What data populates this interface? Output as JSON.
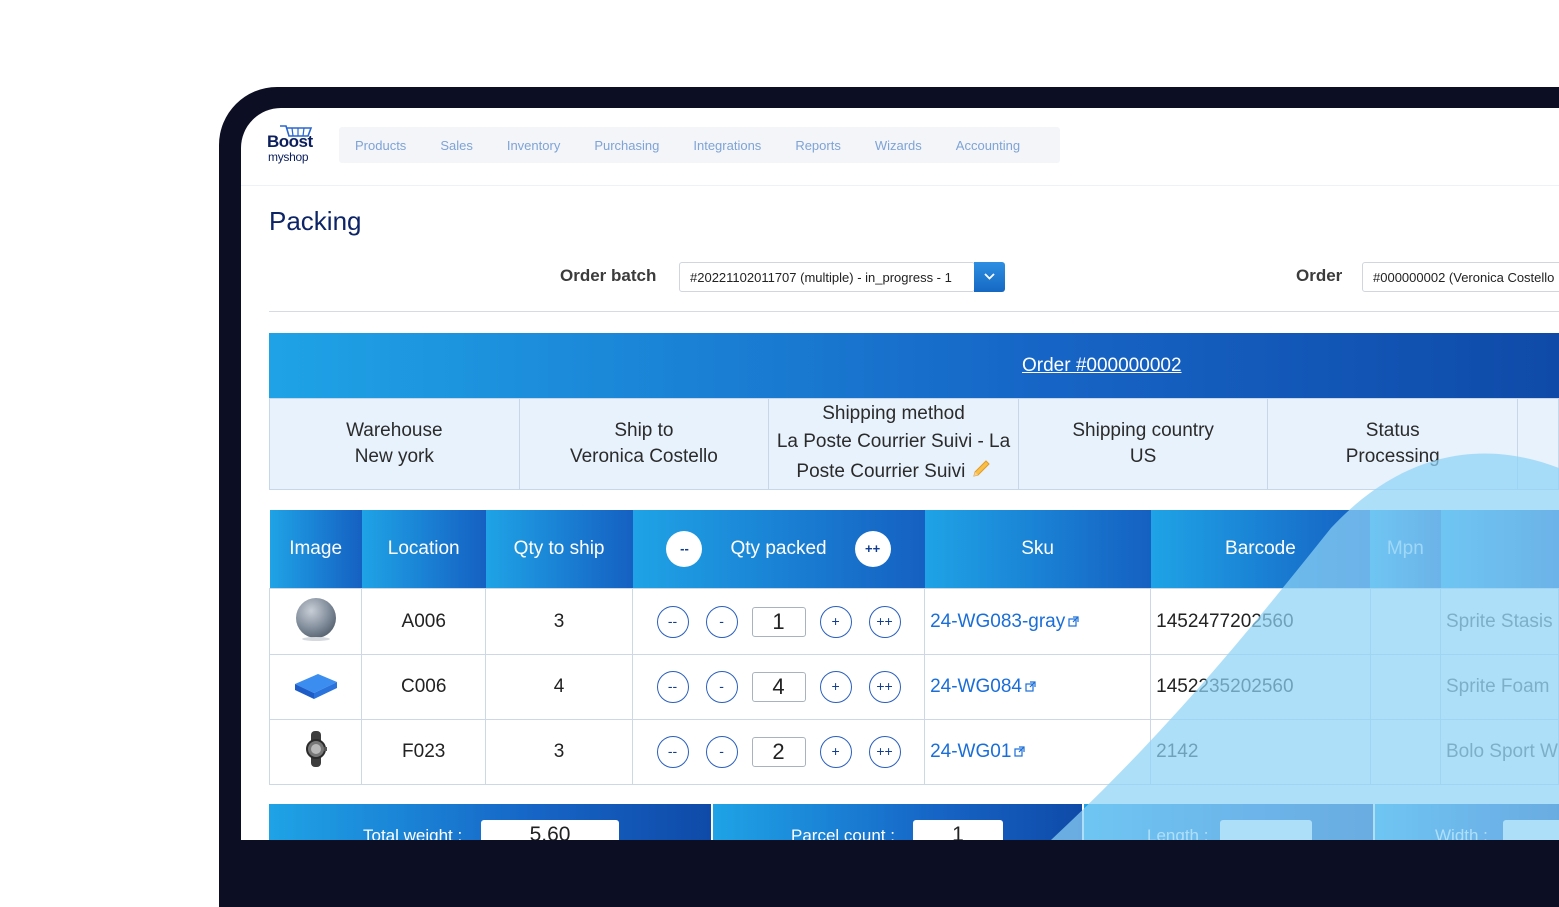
{
  "brand": {
    "logo_top": "Boost",
    "logo_bottom": "myshop"
  },
  "nav": [
    "Products",
    "Sales",
    "Inventory",
    "Purchasing",
    "Integrations",
    "Reports",
    "Wizards",
    "Accounting"
  ],
  "page": {
    "title": "Packing"
  },
  "filters": {
    "order_batch_label": "Order batch",
    "order_batch_value": "#20221102011707 (multiple) - in_progress - 1",
    "order_label": "Order",
    "order_value": "#000000002 (Veronica Costello"
  },
  "order": {
    "title": "Order #000000002",
    "info": [
      {
        "label": "Warehouse",
        "value": "New york"
      },
      {
        "label": "Ship to",
        "value": "Veronica Costello"
      },
      {
        "label": "Shipping method",
        "value": "La Poste Courrier Suivi - La Poste Courrier Suivi"
      },
      {
        "label": "Shipping country",
        "value": "US"
      },
      {
        "label": "Status",
        "value": "Processing"
      }
    ]
  },
  "table": {
    "headers": {
      "image": "Image",
      "location": "Location",
      "qty_to_ship": "Qty to ship",
      "qty_packed": "Qty packed",
      "sku": "Sku",
      "barcode": "Barcode",
      "mpn": "Mpn",
      "minus_all": "--",
      "plus_all": "++"
    },
    "buttons": {
      "minus_all": "--",
      "minus": "-",
      "plus": "+",
      "plus_all": "++"
    },
    "rows": [
      {
        "image": "grey-ball-icon",
        "location": "A006",
        "qty_to_ship": "3",
        "qty_packed": "1",
        "sku": "24-WG083-gray",
        "barcode": "1452477202560",
        "name": "Sprite Stasis"
      },
      {
        "image": "blue-foam-block-icon",
        "location": "C006",
        "qty_to_ship": "4",
        "qty_packed": "4",
        "sku": "24-WG084",
        "barcode": "1452235202560",
        "name": "Sprite Foam"
      },
      {
        "image": "sport-watch-icon",
        "location": "F023",
        "qty_to_ship": "3",
        "qty_packed": "2",
        "sku": "24-WG01",
        "barcode": "2142",
        "name": "Bolo Sport W"
      }
    ]
  },
  "footer": {
    "total_weight_label": "Total weight :",
    "total_weight_value": "5.60",
    "parcel_count_label": "Parcel count :",
    "parcel_count_value": "1",
    "length_label": "Length :",
    "width_label": "Width :"
  },
  "colors": {
    "brand_navy": "#0d2466",
    "accent_blue": "#1a6ed8",
    "header_gradient_start": "#1fa3e6",
    "header_gradient_end": "#0f4aa8"
  }
}
